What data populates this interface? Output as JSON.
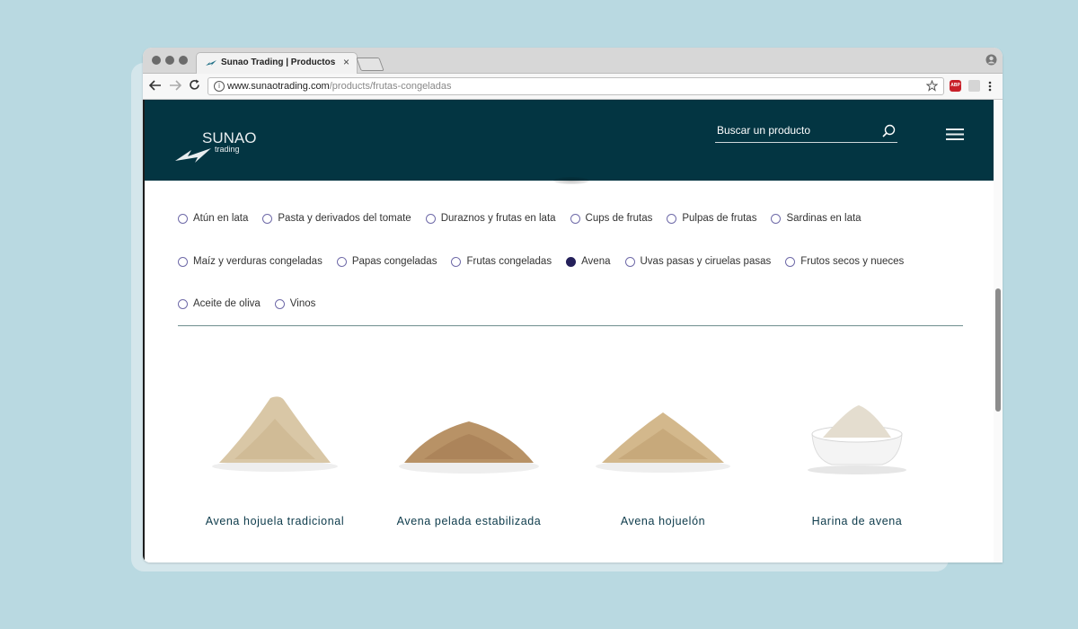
{
  "browser": {
    "tab_title": "Sunao Trading | Productos",
    "tab_close": "×",
    "url_host": "www.sunaotrading.com",
    "url_path": "/products/frutas-congeladas",
    "abp_label": "ABP"
  },
  "site": {
    "logo_top": "SUNAO",
    "logo_bottom": "trading",
    "search_placeholder": "Buscar un producto"
  },
  "filters": {
    "row1": [
      {
        "label": "Atún en lata",
        "checked": false
      },
      {
        "label": "Pasta y derivados del tomate",
        "checked": false
      },
      {
        "label": "Duraznos y frutas en lata",
        "checked": false
      },
      {
        "label": "Cups de frutas",
        "checked": false
      },
      {
        "label": "Pulpas de frutas",
        "checked": false
      },
      {
        "label": "Sardinas en lata",
        "checked": false
      }
    ],
    "row2": [
      {
        "label": "Maíz y verduras congeladas",
        "checked": false
      },
      {
        "label": "Papas congeladas",
        "checked": false
      },
      {
        "label": "Frutas congeladas",
        "checked": false
      },
      {
        "label": "Avena",
        "checked": true
      },
      {
        "label": "Uvas pasas y ciruelas pasas",
        "checked": false
      },
      {
        "label": "Frutos secos y nueces",
        "checked": false
      }
    ],
    "row3": [
      {
        "label": "Aceite de oliva",
        "checked": false
      },
      {
        "label": "Vinos",
        "checked": false
      }
    ]
  },
  "products": [
    {
      "name": "Avena hojuela tradicional"
    },
    {
      "name": "Avena pelada estabilizada"
    },
    {
      "name": "Avena hojuelón"
    },
    {
      "name": "Harina de avena"
    }
  ],
  "colors": {
    "header_bg": "#033542",
    "radio_border": "#6f6aa8",
    "radio_checked": "#24205a",
    "product_text": "#0c3a4a"
  }
}
